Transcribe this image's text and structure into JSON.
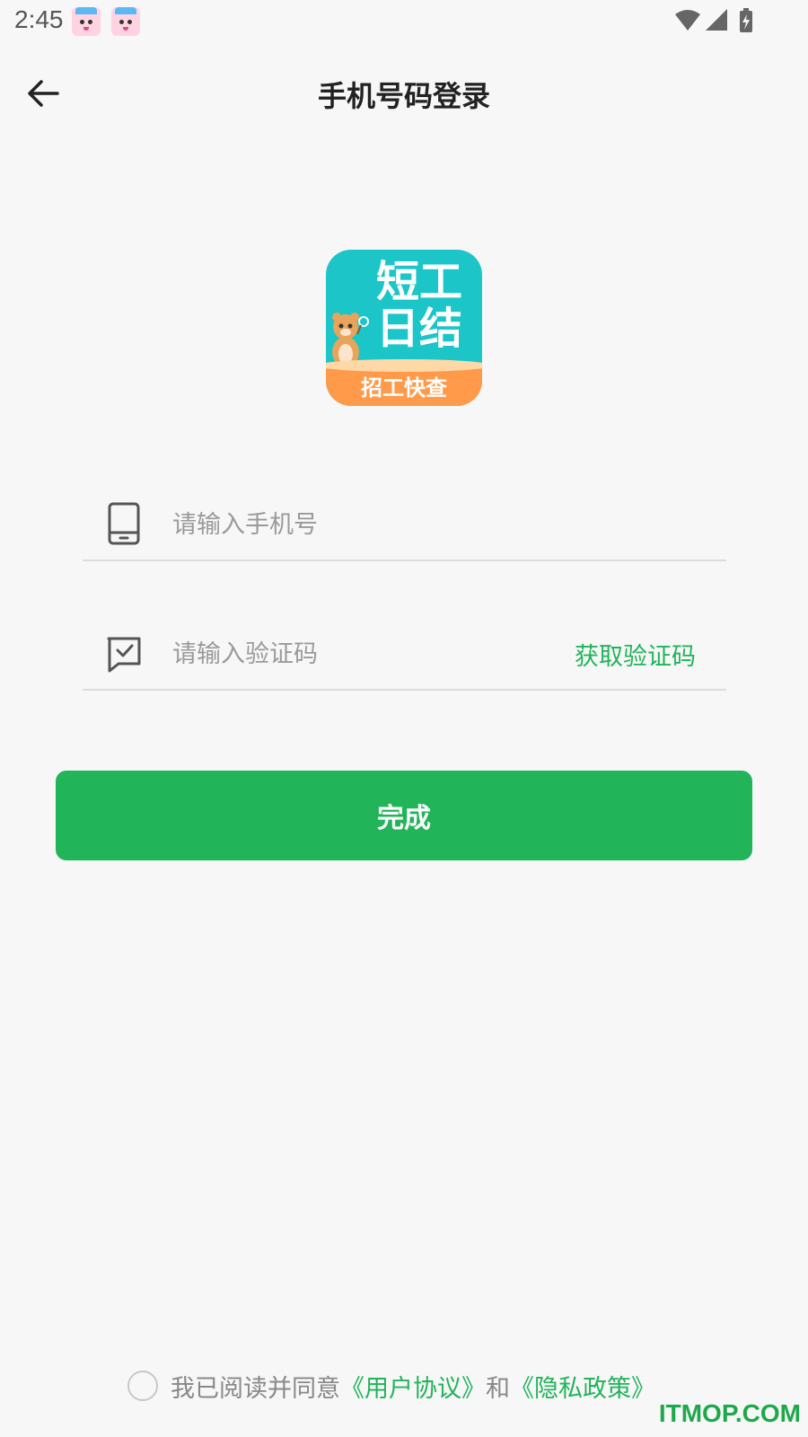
{
  "status_bar": {
    "time": "2:45",
    "icons": [
      "app-notification-icon",
      "app-notification-icon",
      "wifi-icon",
      "cellular-signal-icon",
      "battery-charging-icon"
    ]
  },
  "header": {
    "title": "手机号码登录",
    "back_icon": "arrow-left-icon"
  },
  "logo": {
    "line1": "短工",
    "line2": "日结",
    "band": "招工快查"
  },
  "form": {
    "phone": {
      "icon": "mobile-phone-icon",
      "value": "",
      "placeholder": "请输入手机号"
    },
    "code": {
      "icon": "message-check-icon",
      "value": "",
      "placeholder": "请输入验证码",
      "get_code_label": "获取验证码"
    },
    "submit_label": "完成"
  },
  "agreement": {
    "checked": false,
    "prefix": "我已阅读并同意",
    "user_agreement": "《用户协议》",
    "conjunction": "和",
    "privacy_policy": "《隐私政策》"
  },
  "watermark": "ITMOP.COM",
  "colors": {
    "accent_green": "#21b459",
    "background": "#f7f7f8",
    "logo_teal": "#1cc5c8",
    "logo_orange": "#ff9a4a"
  }
}
